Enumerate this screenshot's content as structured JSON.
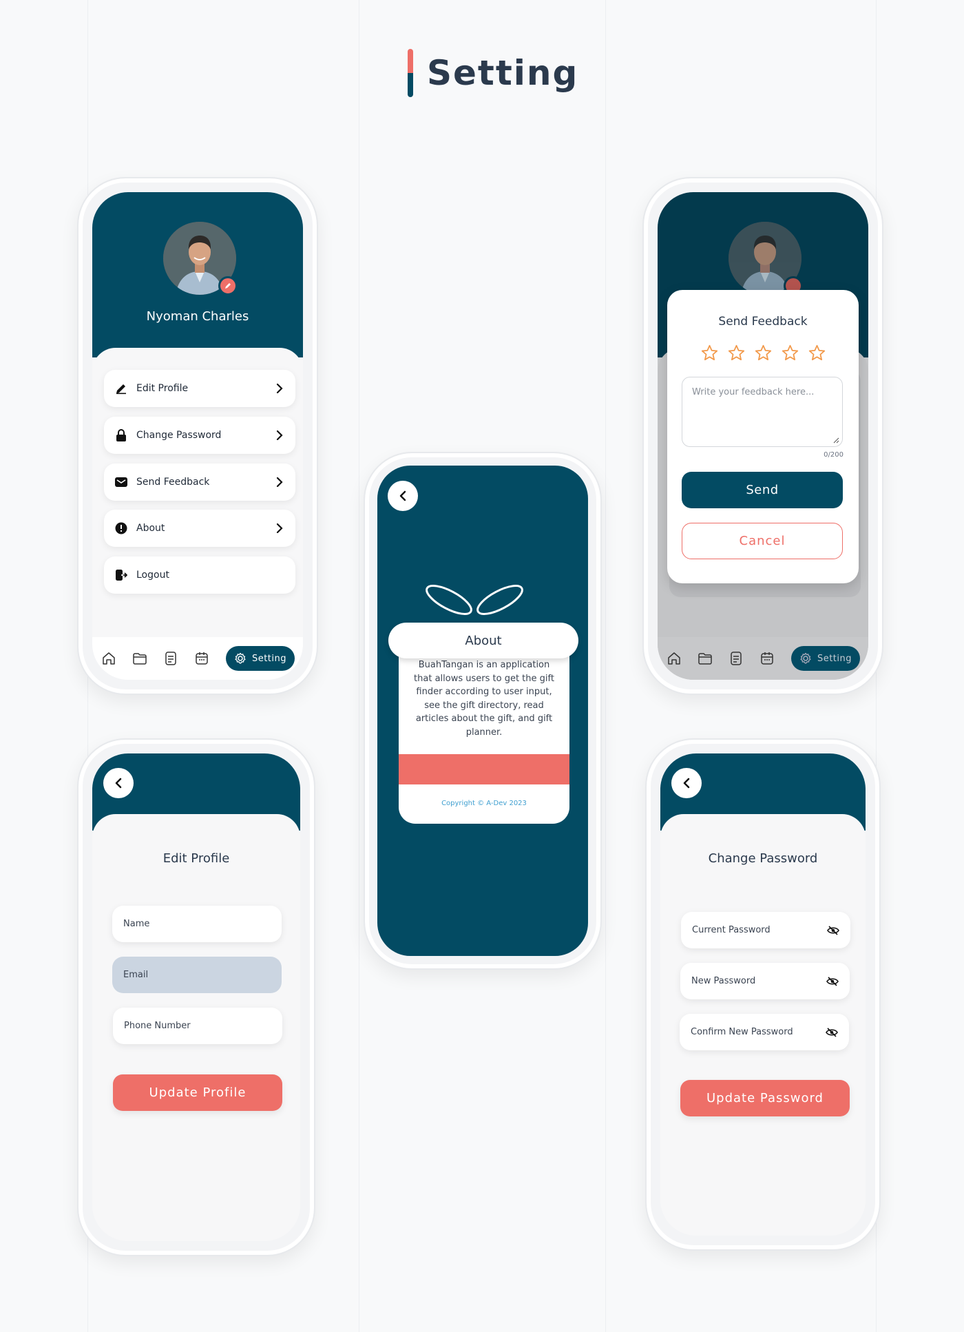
{
  "page": {
    "title": "Setting"
  },
  "colors": {
    "primary": "#034b63",
    "accent": "#ee6f68",
    "background": "#f8f9fa",
    "star": "#f2994a",
    "link": "#3f9fd0"
  },
  "settings_screen": {
    "user_name": "Nyoman Charles",
    "menu": [
      {
        "label": "Edit Profile",
        "icon": "pencil-icon"
      },
      {
        "label": "Change Password",
        "icon": "lock-icon"
      },
      {
        "label": "Send Feedback",
        "icon": "mail-icon"
      },
      {
        "label": "About",
        "icon": "info-icon"
      },
      {
        "label": "Logout",
        "icon": "logout-icon"
      }
    ],
    "tabbar": {
      "active_label": "Setting",
      "icons": [
        "home-icon",
        "folder-icon",
        "document-icon",
        "calendar-icon",
        "gear-icon"
      ]
    }
  },
  "about_screen": {
    "title": "About",
    "description": "BuahTangan is an application that  allows users to get the gift finder according to user input, see the gift directory, read articles about the gift, and gift planner.",
    "copyright": "Copyright © A-Dev 2023"
  },
  "feedback_screen": {
    "title": "Send Feedback",
    "rating_max": 5,
    "placeholder": "Write your feedback here...",
    "counter": "0/200",
    "send_label": "Send",
    "cancel_label": "Cancel",
    "tab_active_label": "Setting"
  },
  "edit_profile_screen": {
    "title": "Edit Profile",
    "fields": [
      {
        "label": "Name"
      },
      {
        "label": "Email"
      },
      {
        "label": "Phone Number"
      }
    ],
    "submit_label": "Update Profile"
  },
  "change_password_screen": {
    "title": "Change Password",
    "fields": [
      {
        "label": "Current Password"
      },
      {
        "label": "New Password"
      },
      {
        "label": "Confirm New Password"
      }
    ],
    "submit_label": "Update Password"
  }
}
